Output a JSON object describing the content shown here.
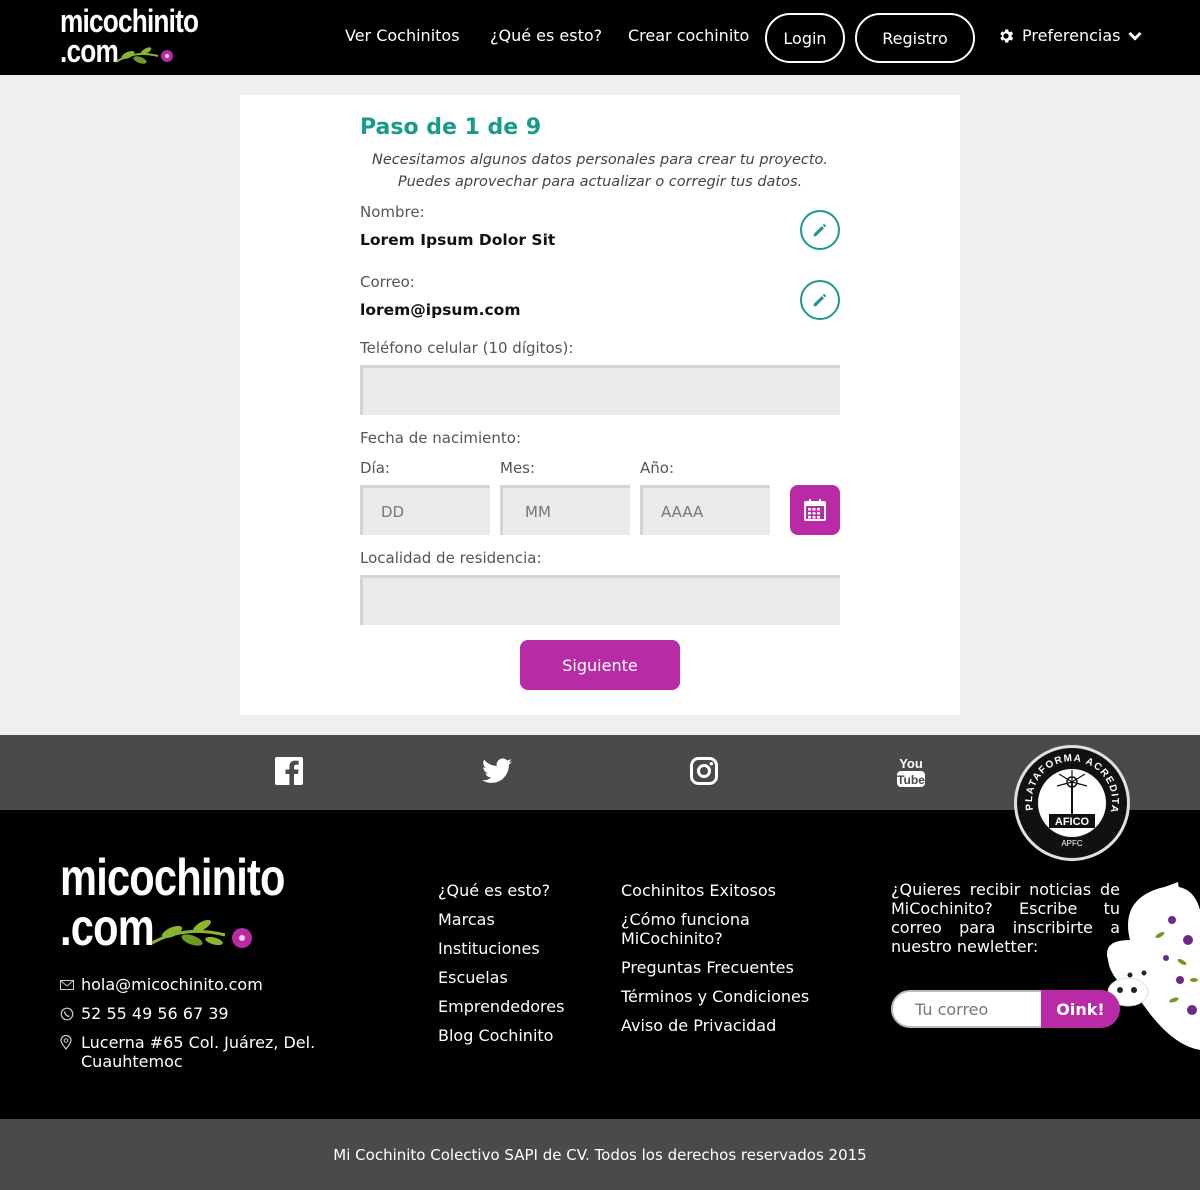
{
  "brand": {
    "line1": "micochinito",
    "line2": ".com"
  },
  "nav": {
    "links": [
      "Ver Cochinitos",
      "¿Qué es esto?",
      "Crear cochinito"
    ],
    "login": "Login",
    "register": "Registro",
    "preferences": "Preferencias"
  },
  "form": {
    "step": "Paso de 1 de 9",
    "intro": "Necesitamos algunos datos personales para crear tu proyecto. Puedes aprovechar para actualizar o corregir tus datos.",
    "name_label": "Nombre:",
    "name_value": "Lorem Ipsum Dolor Sit",
    "email_label": "Correo:",
    "email_value": "lorem@ipsum.com",
    "phone_label": "Teléfono celular (10 dígitos):",
    "phone_value": "",
    "birth_label": "Fecha de nacimiento:",
    "day_label": "Día:",
    "day_placeholder": "DD",
    "month_label": "Mes:",
    "month_placeholder": "MM",
    "year_label": "Año:",
    "year_placeholder": "AAAA",
    "location_label": "Localidad de residencia:",
    "location_value": "",
    "next_button": "Siguiente"
  },
  "social": {
    "icons": [
      "facebook-icon",
      "twitter-icon",
      "instagram-icon",
      "youtube-icon"
    ],
    "badge_text": "PLATAFORMA ACREDITADA",
    "badge_org": "AFICO",
    "badge_sub": "APFC"
  },
  "footer": {
    "email": "hola@micochinito.com",
    "phone": "52 55 49 56 67 39",
    "address": "Lucerna #65 Col. Juárez, Del. Cuauhtemoc",
    "col1": [
      "¿Qué es esto?",
      "Marcas",
      "Instituciones",
      "Escuelas",
      "Emprendedores",
      "Blog Cochinito"
    ],
    "col2": [
      "Cochinitos Exitosos",
      "¿Cómo funciona MiCochinito?",
      "Preguntas Frecuentes",
      "Términos y Condiciones",
      "Aviso de Privacidad"
    ],
    "newsletter_text": "¿Quieres recibir noticias de MiCochinito? Escribe tu correo para inscribirte a nuestro newletter:",
    "newsletter_placeholder": "Tu correo",
    "newsletter_button": "Oink!"
  },
  "copyright": "Mi Cochinito Colectivo SAPI de CV. Todos los derechos reservados 2015",
  "colors": {
    "teal": "#1a9a8a",
    "magenta": "#b82aa6",
    "dark": "#000000",
    "gray": "#4a4a4a"
  }
}
